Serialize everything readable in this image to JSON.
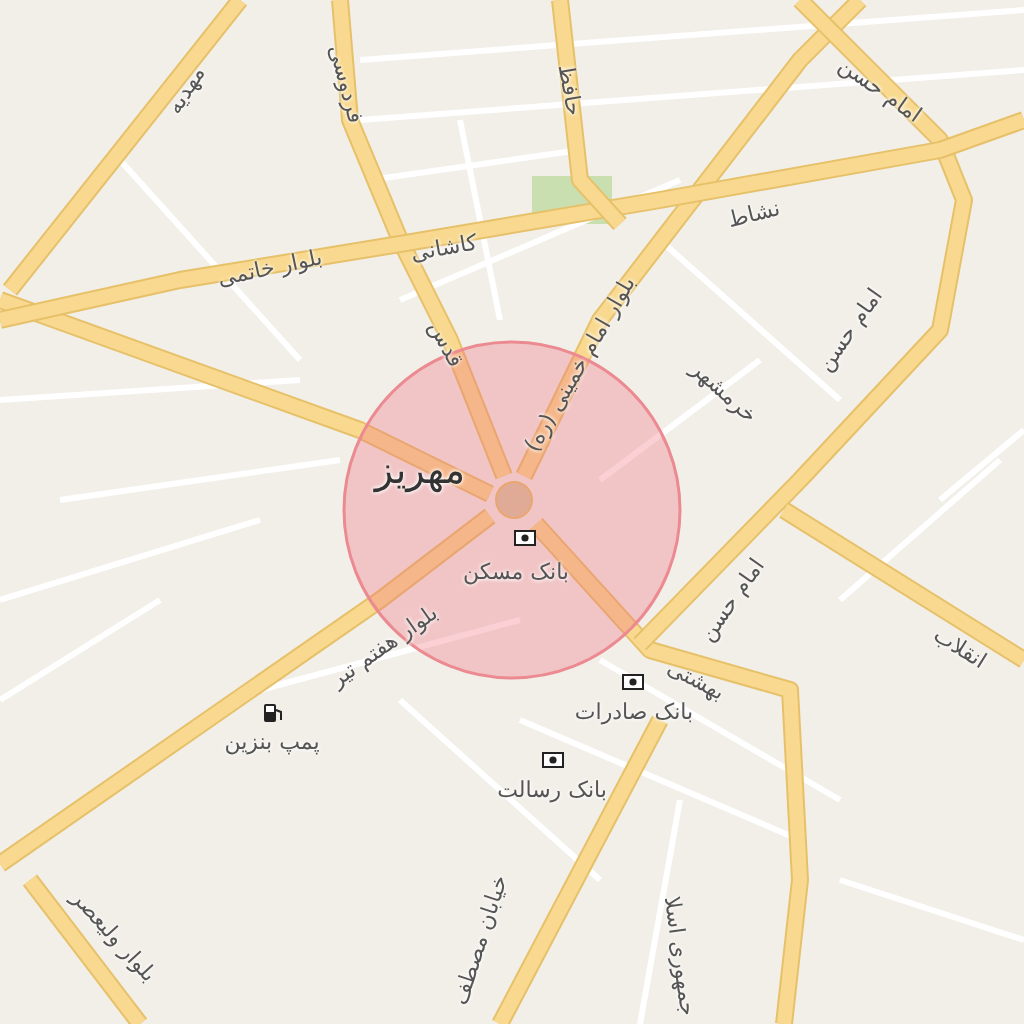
{
  "map": {
    "place_label": "مهریز",
    "streets": [
      {
        "name": "مهدیه"
      },
      {
        "name": "فردوسی"
      },
      {
        "name": "حافظ"
      },
      {
        "name": "امام حسن"
      },
      {
        "name": "نشاط"
      },
      {
        "name": "کاشانی"
      },
      {
        "name": "بلوار خاتمی"
      },
      {
        "name": "قدس"
      },
      {
        "name": "بلوار امام خمینی (ره)"
      },
      {
        "name": "خرمشهر"
      },
      {
        "name": "امام حسن"
      },
      {
        "name": "امام حسن"
      },
      {
        "name": "بهشتی"
      },
      {
        "name": "انقلاب"
      },
      {
        "name": "بلوار هفتم تیر"
      },
      {
        "name": "خیابان مصطف"
      },
      {
        "name": "جمهوری اسلا"
      },
      {
        "name": "بلوار ولیعصر"
      }
    ],
    "pois": [
      {
        "kind": "bank",
        "name": "بانک مسکن"
      },
      {
        "kind": "bank",
        "name": "بانک صادرات"
      },
      {
        "kind": "bank",
        "name": "بانک رسالت"
      },
      {
        "kind": "fuel",
        "name": "پمپ بنزین"
      }
    ]
  }
}
